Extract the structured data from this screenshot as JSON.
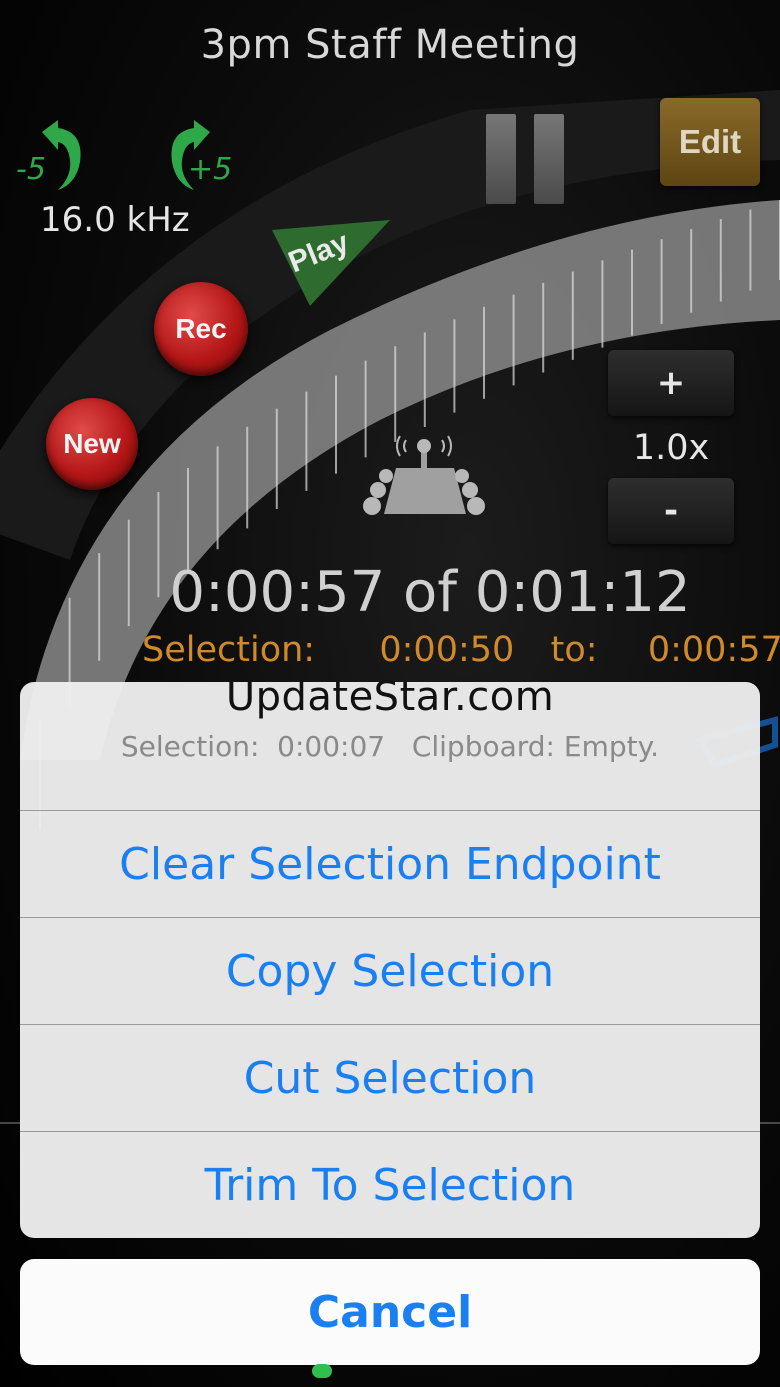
{
  "title": "3pm Staff Meeting",
  "sample_rate": "16.0 kHz",
  "skip_back_label": "-5",
  "skip_forward_label": "+5",
  "buttons": {
    "new": "New",
    "rec": "Rec",
    "play": "Play",
    "edit": "Edit",
    "zoom_in": "+",
    "zoom_out": "-"
  },
  "zoom_level": "1.0x",
  "playback": {
    "time_display": "0:00:57 of 0:01:12"
  },
  "selection_line": {
    "label": "Selection:",
    "start": "0:00:50",
    "to_label": "to:",
    "end": "0:00:57"
  },
  "watermark": "UpdateStar.com",
  "action_sheet": {
    "header": "Selection:  0:00:07   Clipboard: Empty.",
    "items": [
      "Clear Selection Endpoint",
      "Copy Selection",
      "Cut Selection",
      "Trim To Selection"
    ],
    "cancel": "Cancel"
  },
  "colors": {
    "accent_blue": "#1a7ff0",
    "selection_orange": "#d08a2a",
    "record_red": "#b41616",
    "play_green": "#2e6b2e",
    "edit_gold": "#7a5a1e"
  },
  "icons": [
    "undo-arrow-icon",
    "redo-arrow-icon",
    "pause-icon",
    "microphone-podium-icon"
  ]
}
